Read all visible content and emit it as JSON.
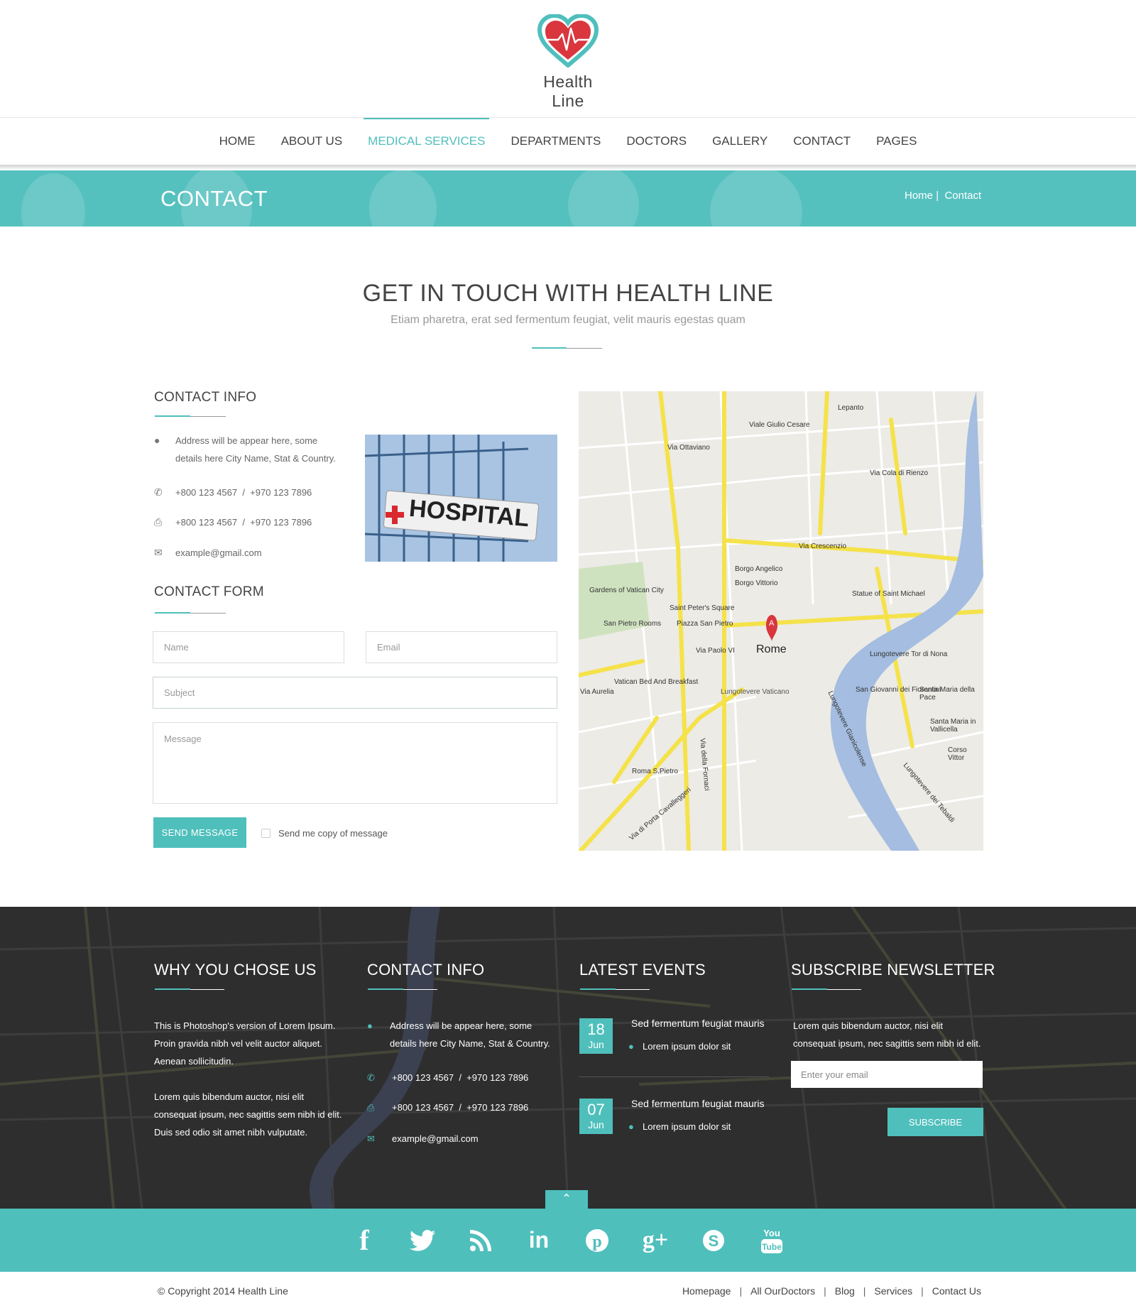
{
  "brand": {
    "name": "Health Line",
    "accent": "#4fbfbc",
    "dark": "#2e2e2e"
  },
  "nav": {
    "items": [
      "HOME",
      "ABOUT US",
      "MEDICAL SERVICES",
      "DEPARTMENTS",
      "DOCTORS",
      "GALLERY",
      "CONTACT",
      "PAGES"
    ],
    "active": "MEDICAL SERVICES"
  },
  "banner": {
    "title": "CONTACT",
    "crumb_home": "Home",
    "crumb_sep": "|",
    "crumb_current": "Contact"
  },
  "section": {
    "title": "GET IN TOUCH WITH HEALTH LINE",
    "subtitle": "Etiam pharetra, erat sed fermentum feugiat, velit mauris egestas quam"
  },
  "contact_info": {
    "heading": "CONTACT INFO",
    "address_line1": "Address will be appear here, some",
    "address_line2": "details here City Name, Stat & Country.",
    "phone": "+800 123 4567  /  +970 123 7896",
    "fax": "+800 123 4567  /  +970 123 7896",
    "email": "example@gmail.com",
    "image_text": "HOSPITAL"
  },
  "contact_form": {
    "heading": "CONTACT FORM",
    "name_placeholder": "Name",
    "email_placeholder": "Email",
    "subject_placeholder": "Subject",
    "message_placeholder": "Message",
    "send_label": "SEND MESSAGE",
    "copy_label": "Send me copy of message"
  },
  "map": {
    "center_label": "Rome",
    "marker": "A",
    "labels": [
      "Via Ottaviano",
      "Viale Giulio Cesare",
      "Via Crescenzio",
      "Saint Peter's Square",
      "Piazza San Pietro",
      "Gardens of Vatican City",
      "San Pietro Rooms",
      "Vatican Bed And Breakfast",
      "Statue of Saint Michael",
      "San Giovanni dei Fiorentini",
      "Santa Maria della Pace",
      "Santa Maria in Vallicella",
      "Lungotevere Vaticano",
      "Lungotevere Tor di Nona",
      "Lungotevere Gianicolense",
      "Via della Fornaci",
      "Roma S.Pietro",
      "Lepanto",
      "Via Cola di Rienzo",
      "Via Aurelia",
      "Corso Vittor",
      "Borgo Angelico",
      "Borgo Vittorio",
      "Via Paolo VI",
      "Via di Porta Cavalleggeri",
      "Lungotevere dei Tebaldi"
    ]
  },
  "footer": {
    "why": {
      "heading": "WHY YOU CHOSE US",
      "p1": [
        "This is Photoshop's version  of Lorem Ipsum.",
        "Proin gravida nibh vel velit auctor aliquet.",
        "Aenean sollicitudin."
      ],
      "p2": [
        "Lorem quis bibendum auctor, nisi elit",
        "consequat ipsum, nec sagittis sem nibh id elit.",
        "Duis sed odio sit amet nibh vulputate."
      ]
    },
    "contact": {
      "heading": "CONTACT INFO",
      "address_line1": "Address will be appear here, some",
      "address_line2": "details here City Name, Stat & Country.",
      "phone": "+800 123 4567  /  +970 123 7896",
      "fax": "+800 123 4567  /  +970 123 7896",
      "email": "example@gmail.com"
    },
    "events": {
      "heading": "LATEST EVENTS",
      "items": [
        {
          "day": "18",
          "month": "Jun",
          "title": "Sed fermentum feugiat mauris",
          "location": "Lorem ipsum dolor sit"
        },
        {
          "day": "07",
          "month": "Jun",
          "title": "Sed fermentum feugiat mauris",
          "location": "Lorem ipsum dolor sit"
        }
      ]
    },
    "newsletter": {
      "heading": "SUBSCRIBE NEWSLETTER",
      "text1": "Lorem quis bibendum auctor, nisi elit",
      "text2": "consequat ipsum, nec sagittis sem nibh id elit.",
      "placeholder": "Enter your email",
      "button": "SUBSCRIBE"
    }
  },
  "social": [
    "facebook",
    "twitter",
    "rss",
    "linkedin",
    "pinterest",
    "google-plus",
    "skype",
    "youtube"
  ],
  "bottom": {
    "copyright": "© Copyright 2014 Health Line",
    "links": [
      "Homepage",
      "All OurDoctors",
      "Blog",
      "Services",
      "Contact Us"
    ]
  }
}
